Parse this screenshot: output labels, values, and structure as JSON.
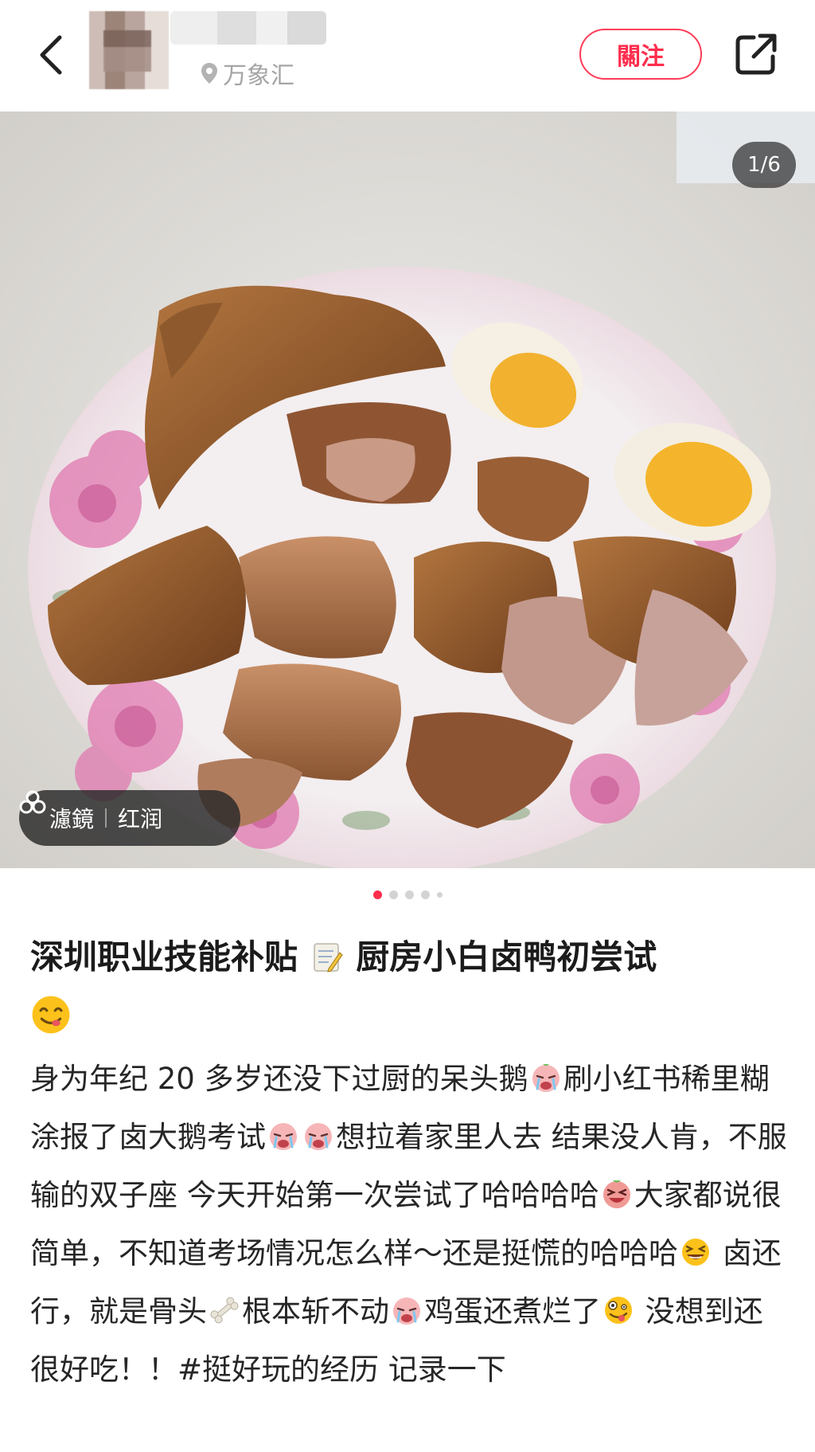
{
  "header": {
    "location": "万象汇",
    "follow_label": "關注"
  },
  "photo": {
    "counter": "1/6",
    "filter_label": "濾鏡",
    "filter_value": "红润",
    "dots": 5,
    "active_dot": 0
  },
  "post": {
    "title_part1": "深圳职业技能补贴",
    "title_part2": "厨房小白卤鸭初尝试",
    "body": [
      {
        "t": "身为年纪 20 多岁还没下过厨的呆头鹅"
      },
      {
        "t": "刷小红书稀里糊涂报了卤大鹅考试"
      },
      {
        "t": "想拉着家里人去 结果没人肯，不服输的双子座 今天开始第一次尝试了哈哈哈哈"
      },
      {
        "t": "大家都说很简单，不知道考场情况怎么样～还是挺慌的哈哈哈"
      },
      {
        "t": "卤还行，就是骨头"
      },
      {
        "t": "根本斩不动"
      },
      {
        "t": "鸡蛋还煮烂了"
      },
      {
        "t": "没想到还很好吃！！"
      },
      {
        "t": "#挺好玩的经历 记录一下"
      }
    ]
  },
  "colors": {
    "accent": "#ff2e4d",
    "text": "#262626",
    "muted": "#a5a5a5"
  }
}
